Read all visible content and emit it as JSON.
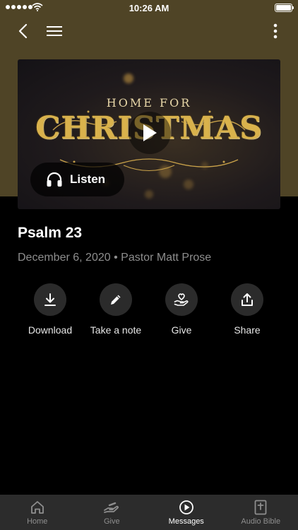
{
  "status_bar": {
    "time": "10:26 AM"
  },
  "artwork": {
    "line1": "HOME FOR",
    "line2": "CHRISTMAS"
  },
  "listen": {
    "label": "Listen"
  },
  "message": {
    "title": "Psalm 23",
    "date": "December 6, 2020",
    "separator": "•",
    "speaker": "Pastor Matt Prose"
  },
  "actions": [
    {
      "label": "Download",
      "icon": "download-icon"
    },
    {
      "label": "Take a note",
      "icon": "pencil-icon"
    },
    {
      "label": "Give",
      "icon": "heart-hand-icon"
    },
    {
      "label": "Share",
      "icon": "share-icon"
    }
  ],
  "tabs": [
    {
      "label": "Home",
      "icon": "home-icon",
      "active": false
    },
    {
      "label": "Give",
      "icon": "give-hand-icon",
      "active": false
    },
    {
      "label": "Messages",
      "icon": "play-circle-icon",
      "active": true
    },
    {
      "label": "Audio Bible",
      "icon": "bible-icon",
      "active": false
    }
  ],
  "colors": {
    "header_background": "#4f4426",
    "page_background": "#000000",
    "tab_bar": "#2c2c2c",
    "action_circle": "#2b2b2b",
    "muted_text": "#8e8e8e",
    "title_gold": "#d9b24c"
  }
}
